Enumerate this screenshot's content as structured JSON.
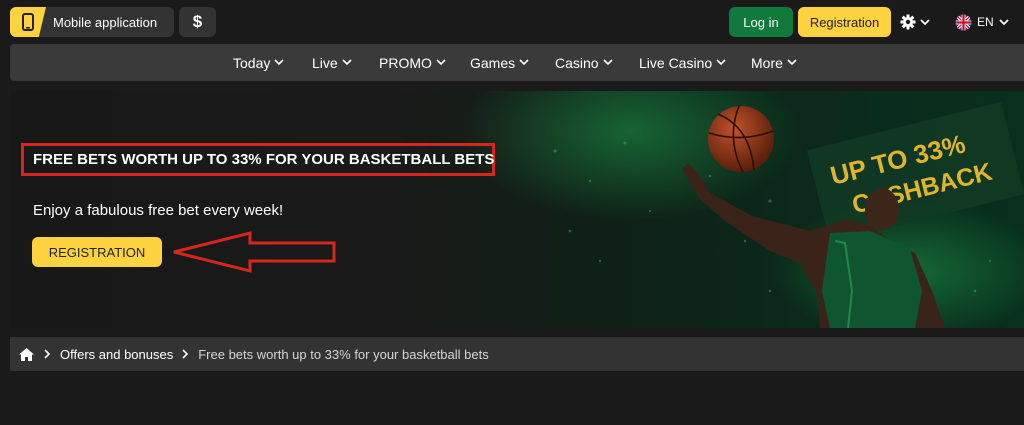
{
  "header": {
    "mobile_app_label": "Mobile application",
    "currency_symbol": "$",
    "login_label": "Log in",
    "registration_label": "Registration",
    "language": "EN"
  },
  "nav": {
    "items": [
      {
        "label": "Today"
      },
      {
        "label": "Live"
      },
      {
        "label": "PROMO"
      },
      {
        "label": "Games"
      },
      {
        "label": "Casino"
      },
      {
        "label": "Live Casino"
      },
      {
        "label": "More"
      }
    ]
  },
  "hero": {
    "title": "FREE BETS WORTH UP TO 33% FOR YOUR BASKETBALL BETS",
    "subtitle": "Enjoy a fabulous free bet every week!",
    "button_label": "REGISTRATION",
    "sign_line1": "UP TO 33%",
    "sign_line2": "CASHBACK"
  },
  "breadcrumb": {
    "parent": "Offers and bonuses",
    "current": "Free bets worth up to 33% for your basketball bets"
  },
  "colors": {
    "accent_yellow": "#ffd23f",
    "login_green": "#11793c",
    "highlight_red": "#d7261e",
    "background": "#1a1a1a"
  }
}
